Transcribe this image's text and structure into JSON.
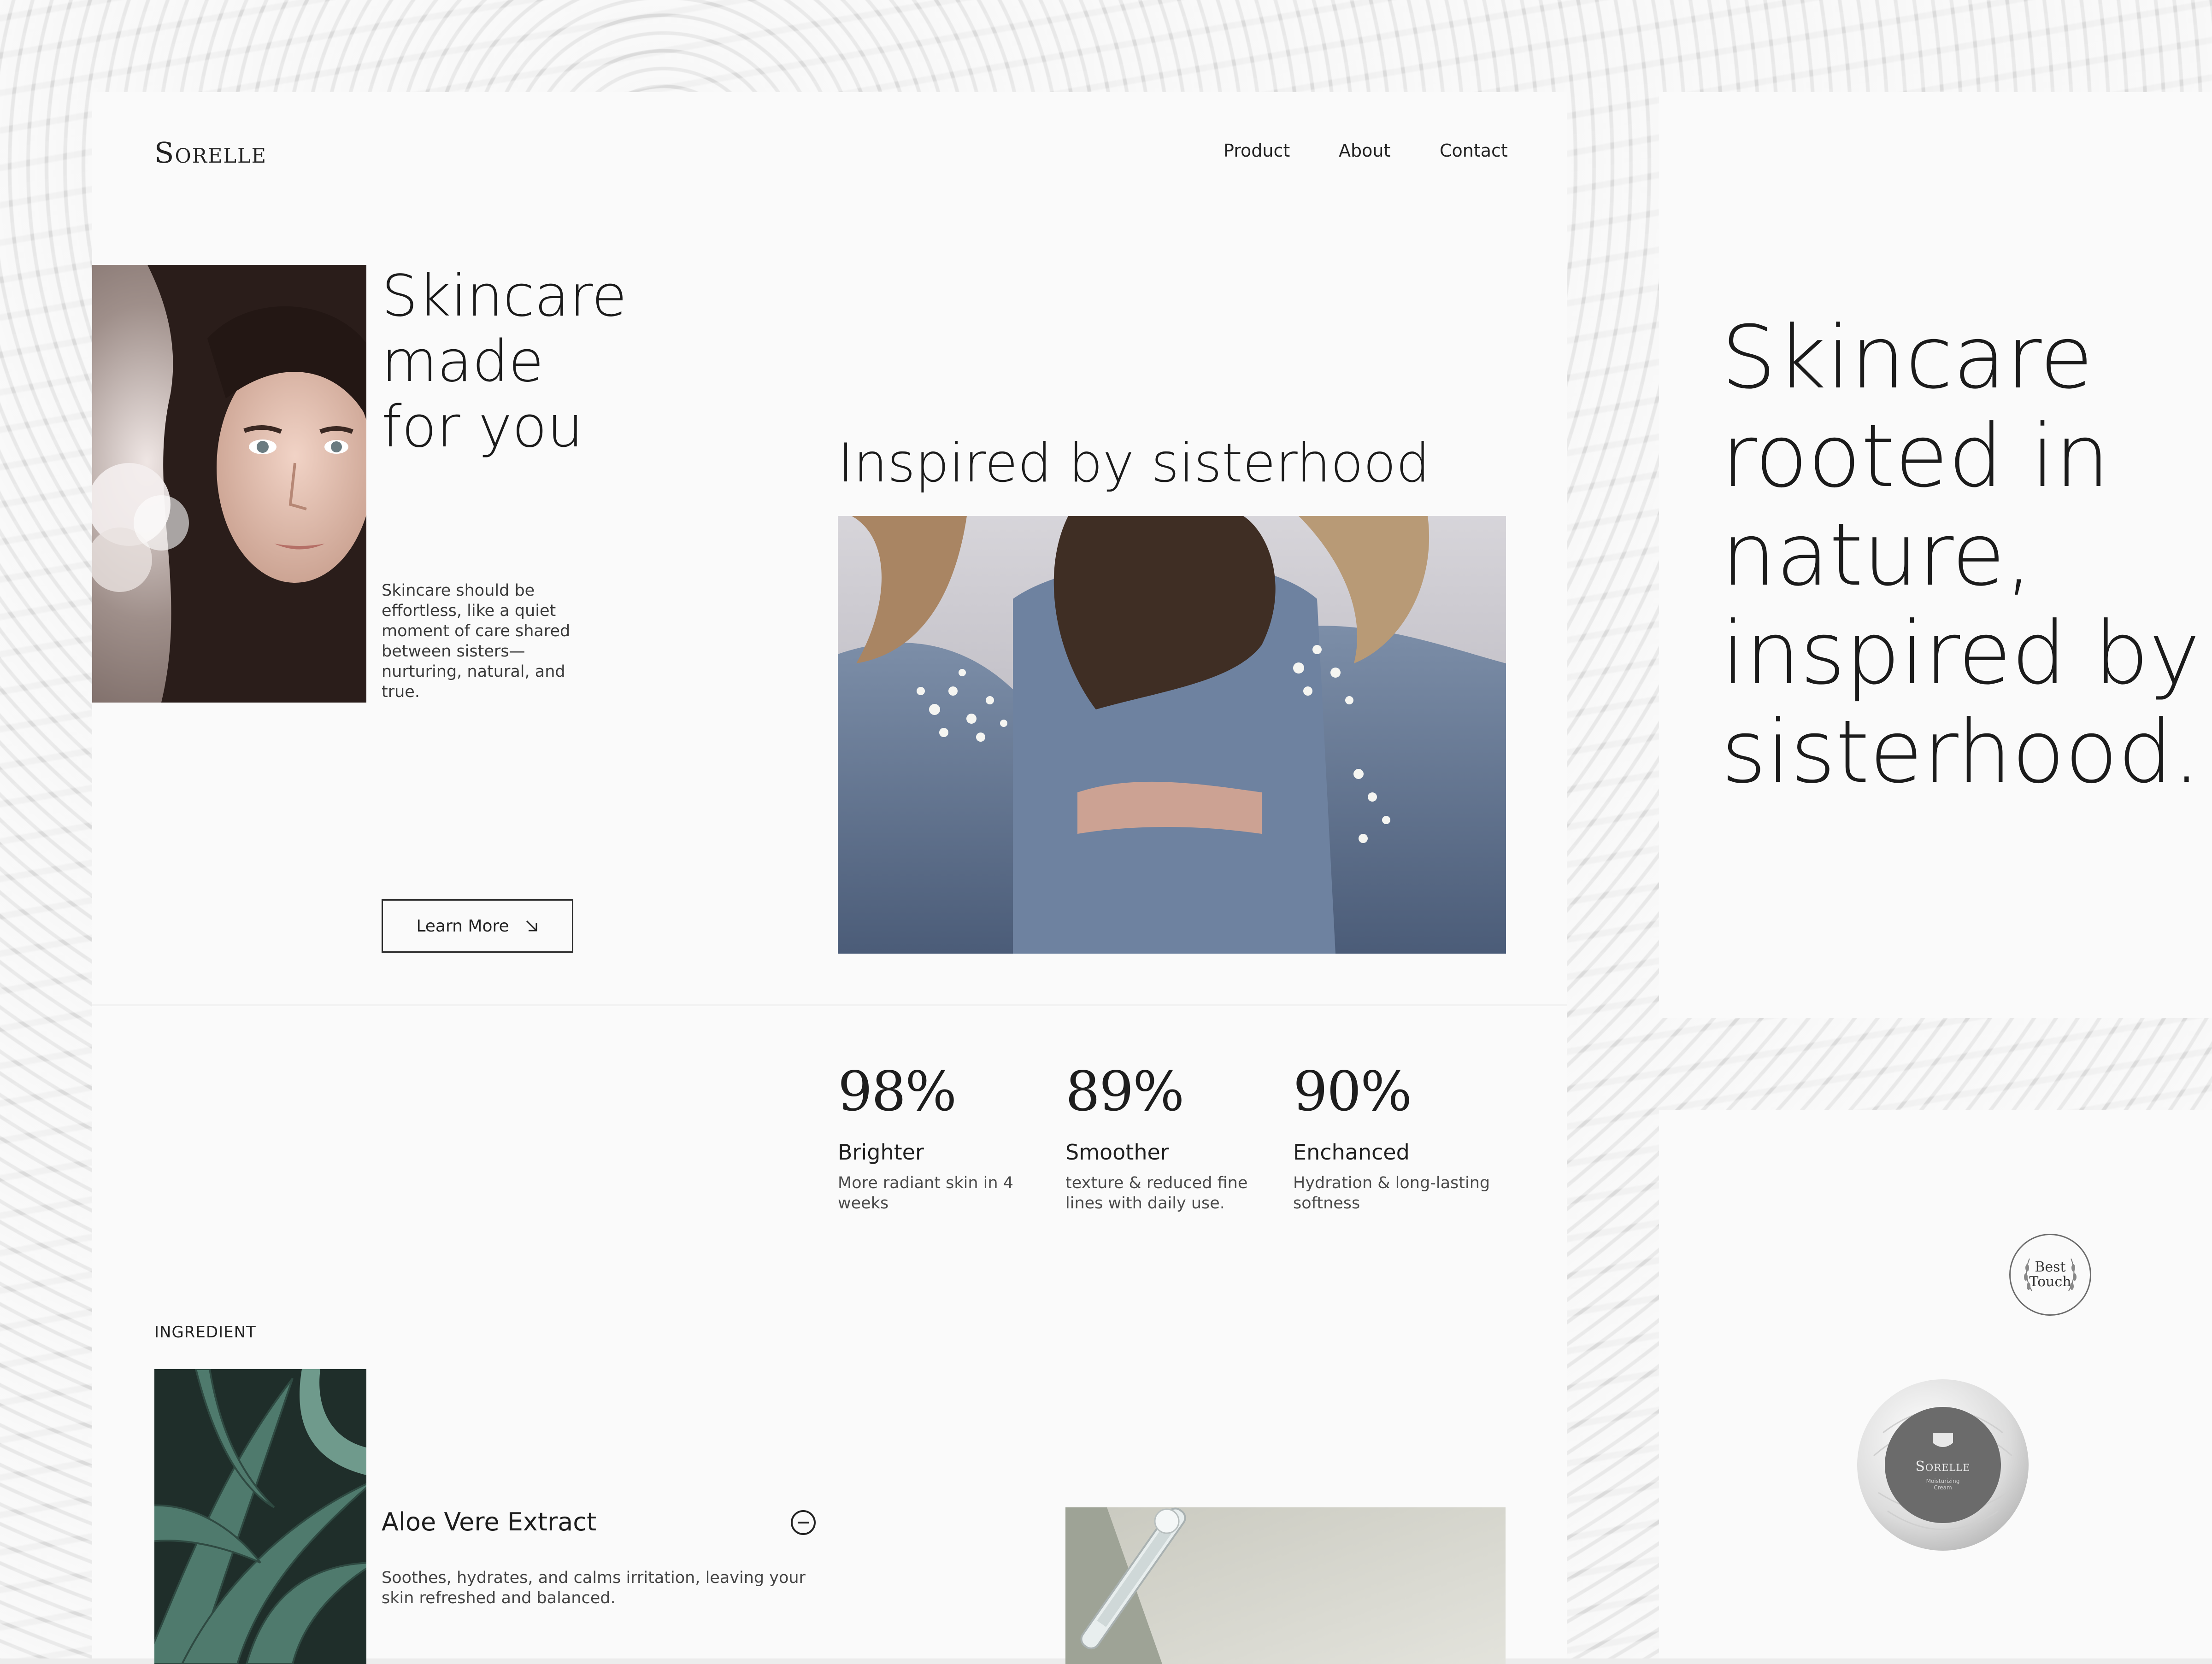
{
  "brand": {
    "logo": "Sorelle"
  },
  "nav": {
    "items": [
      "Product",
      "About",
      "Contact"
    ]
  },
  "hero": {
    "title_line1": "Skincare made",
    "title_line2": "for you",
    "body": "Skincare should be effortless, like a quiet moment of care shared between sisters—nurturing, natural, and true.",
    "button_label": "Learn More"
  },
  "sisterhood": {
    "title": "Inspired by sisterhood"
  },
  "stats": [
    {
      "value": "98%",
      "label": "Brighter",
      "desc": "More radiant skin in 4 weeks"
    },
    {
      "value": "89%",
      "label": "Smoother",
      "desc": "texture & reduced fine lines with daily use."
    },
    {
      "value": "90%",
      "label": "Enchanced",
      "desc": "Hydration & long-lasting softness"
    }
  ],
  "ingredient": {
    "section_label": "INGREDIENT",
    "title": "Aloe Vere Extract",
    "desc": "Soothes, hydrates, and calms irritation, leaving your skin refreshed and balanced."
  },
  "right_panel": {
    "headline": [
      "Skincare",
      "rooted in",
      "nature,",
      "inspired by",
      "sisterhood."
    ]
  },
  "badge": {
    "line1": "Best",
    "line2": "Touch"
  },
  "jar": {
    "brand": "Sorelle",
    "subtitle": "Moisturizing Cream"
  }
}
